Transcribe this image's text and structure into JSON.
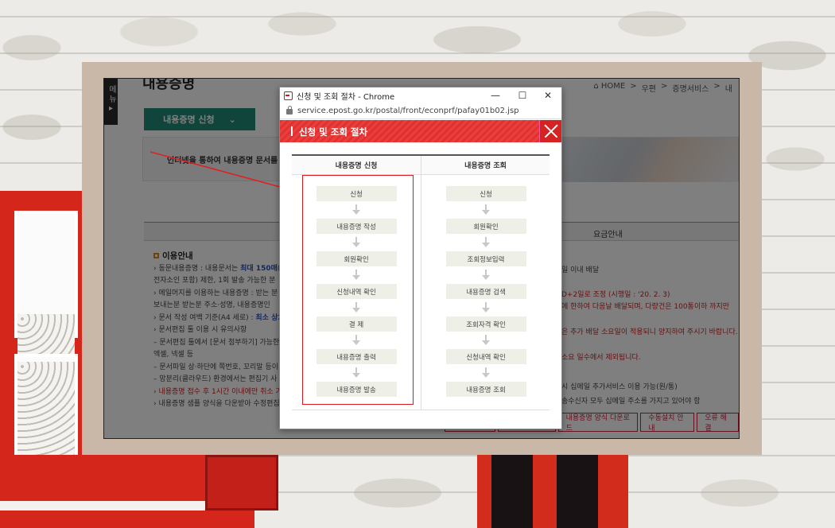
{
  "site": {
    "menu_label": "메뉴",
    "menu_arrow": "▸",
    "page_title": "내용증명",
    "breadcrumbs": [
      "⌂ HOME",
      ">",
      "우편",
      ">",
      "증명서비스",
      ">",
      "내"
    ],
    "tab_button": "내용증명 신청",
    "tab_caret": "⌄",
    "banner_text": "인터넷을 통하여 내용증명 문서를 작",
    "table_right_header": "요금안내",
    "usage": {
      "heading": "이용안내",
      "lines": [
        {
          "prefix": "› 동문내용증명 : 내용문서는 ",
          "strong": "최대 150매",
          "suffix": "("
        },
        {
          "prefix": "  전자소인 포함) 제한, 1회 발송 가능한 분",
          "strong": "",
          "suffix": ""
        },
        {
          "prefix": "› 메일머지를 이용하는 내용증명 : 받는 분 ",
          "strong": "",
          "suffix": ""
        },
        {
          "prefix": "  보내는분 받는분 주소·성명, 내용증명인",
          "strong": "",
          "suffix": ""
        },
        {
          "prefix": "› 문서 작성 여백 기준(A4 세로) : ",
          "strong": "최소 상2",
          "suffix": ""
        },
        {
          "prefix": "› 문서편집 툴 이용 시 유의사항",
          "strong": "",
          "suffix": ""
        },
        {
          "prefix": "   – 문서편집 툴에서 [문서 첨부하기] 가능한",
          "strong": "",
          "suffix": ""
        },
        {
          "prefix": "     엑셀, 넥셀 등",
          "strong": "",
          "suffix": ""
        },
        {
          "prefix": "   – 문서파일 상·하단에 쪽번호, 꼬리말 등이 ",
          "strong": "",
          "suffix": ""
        },
        {
          "prefix": "   – 망분리(클라우드) 환경에서는 편집기 사",
          "strong": "",
          "suffix": ""
        },
        {
          "prefix": "› 내용증명 접수 후 1시간 이내에만 취소 가",
          "strong": "",
          "suffix": "",
          "red": true
        },
        {
          "prefix": "› 내용증명 샘플 양식을 다운받아 수정편집",
          "strong": "",
          "suffix": ""
        }
      ],
      "right_fragments": [
        "일 이내 배달",
        "D+2일로 조정 (시행일 : '20. 2. 3)",
        "에 한하여 다음날 배달되며, 다량건은 100통이하 까지만",
        "은 추가 배달 소요일이 적용되니 양지하여 주시기 바랍니다.",
        "소요 일수에서 제외됩니다.",
        "시 십메일 추가서비스 이용 가능(원/통)",
        "송수신자 모두 십메일 주소를 가지고 있어야 함"
      ]
    },
    "bottom_buttons": [
      "",
      "",
      "내용증명 양식 다운로드",
      "수동설치 안내",
      "오류 해결"
    ]
  },
  "popup": {
    "window_title": "신청 및 조회 절차 - Chrome",
    "controls": {
      "minimize": "—",
      "maximize": "☐",
      "close": "✕"
    },
    "url": "service.epost.go.kr/postal/front/econprf/pafay01b02.jsp",
    "header_title": "신청 및 조회 절차",
    "left_column": {
      "heading": "내용증명 신청",
      "steps": [
        "신청",
        "내용증명 작성",
        "회원확인",
        "신청내역 확인",
        "결 제",
        "내용증명 출력",
        "내용증명 발송"
      ]
    },
    "right_column": {
      "heading": "내용증명 조회",
      "steps": [
        "신청",
        "회원확인",
        "조회정보입력",
        "내용증명 검색",
        "조회자격 확인",
        "신청내역 확인",
        "내용증명 조회"
      ]
    }
  },
  "colors": {
    "accent_red": "#e2302f",
    "highlight_box": "#d71920",
    "tab_green": "#1f8a77",
    "frame_beige": "#c9b7a8"
  },
  "icons": [
    "post-logo-icon",
    "lock-icon",
    "close-icon",
    "down-arrow-icon",
    "home-icon"
  ]
}
